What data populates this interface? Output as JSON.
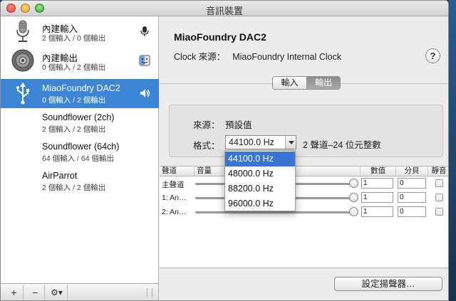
{
  "window": {
    "title": "音訊裝置"
  },
  "sidebar": {
    "devices": [
      {
        "name": "內建輸入",
        "sub": "2 個輸入 / 0 個輸出",
        "icon": "microphone-icon",
        "right_icon": "mic-small-icon",
        "selected": false
      },
      {
        "name": "內建輸出",
        "sub": "0 個輸入 / 2 個輸出",
        "icon": "speaker-icon",
        "right_icon": "finder-icon",
        "selected": false
      },
      {
        "name": "MiaoFoundry DAC2",
        "sub": "0 個輸入 / 2 個輸出",
        "icon": "usb-icon",
        "right_icon": "volume-icon",
        "selected": true
      },
      {
        "name": "Soundflower (2ch)",
        "sub": "2 個輸入 / 2 個輸出",
        "icon": "",
        "right_icon": "",
        "selected": false
      },
      {
        "name": "Soundflower (64ch)",
        "sub": "64 個輸入 / 64 個輸出",
        "icon": "",
        "right_icon": "",
        "selected": false
      },
      {
        "name": "AirParrot",
        "sub": "2 個輸入 / 2 個輸出",
        "icon": "",
        "right_icon": "",
        "selected": false
      }
    ],
    "bottom": {
      "add": "+",
      "remove": "−",
      "gear": "⚙▾"
    }
  },
  "main": {
    "device_title": "MiaoFoundry DAC2",
    "clock_label": "Clock 來源：",
    "clock_value": "MiaoFoundry Internal Clock",
    "help": "?",
    "tabs": [
      {
        "label": "輸入",
        "active": false
      },
      {
        "label": "輸出",
        "active": true
      }
    ],
    "source_label": "來源：",
    "source_value": "預設值",
    "format_label": "格式：",
    "format_value": "44100.0 Hz",
    "format_desc": "2 聲道–24 位元整數",
    "table": {
      "headers": {
        "channel": "聲道",
        "volume": "音量",
        "value": "數值",
        "db": "分貝",
        "mute": "靜音"
      },
      "rows": [
        {
          "name": "主聲道",
          "value": "1",
          "db": "0"
        },
        {
          "name": "1: An…",
          "value": "1",
          "db": "0"
        },
        {
          "name": "2: An…",
          "value": "1",
          "db": "0"
        }
      ]
    },
    "configure_speakers": "設定揚聲器…",
    "dropdown": {
      "options": [
        "44100.0 Hz",
        "48000.0 Hz",
        "88200.0 Hz",
        "96000.0 Hz"
      ],
      "highlighted": "44100.0 Hz"
    }
  },
  "colors": {
    "selection": "#3b85d4",
    "menu_highlight": "#3875d7"
  }
}
